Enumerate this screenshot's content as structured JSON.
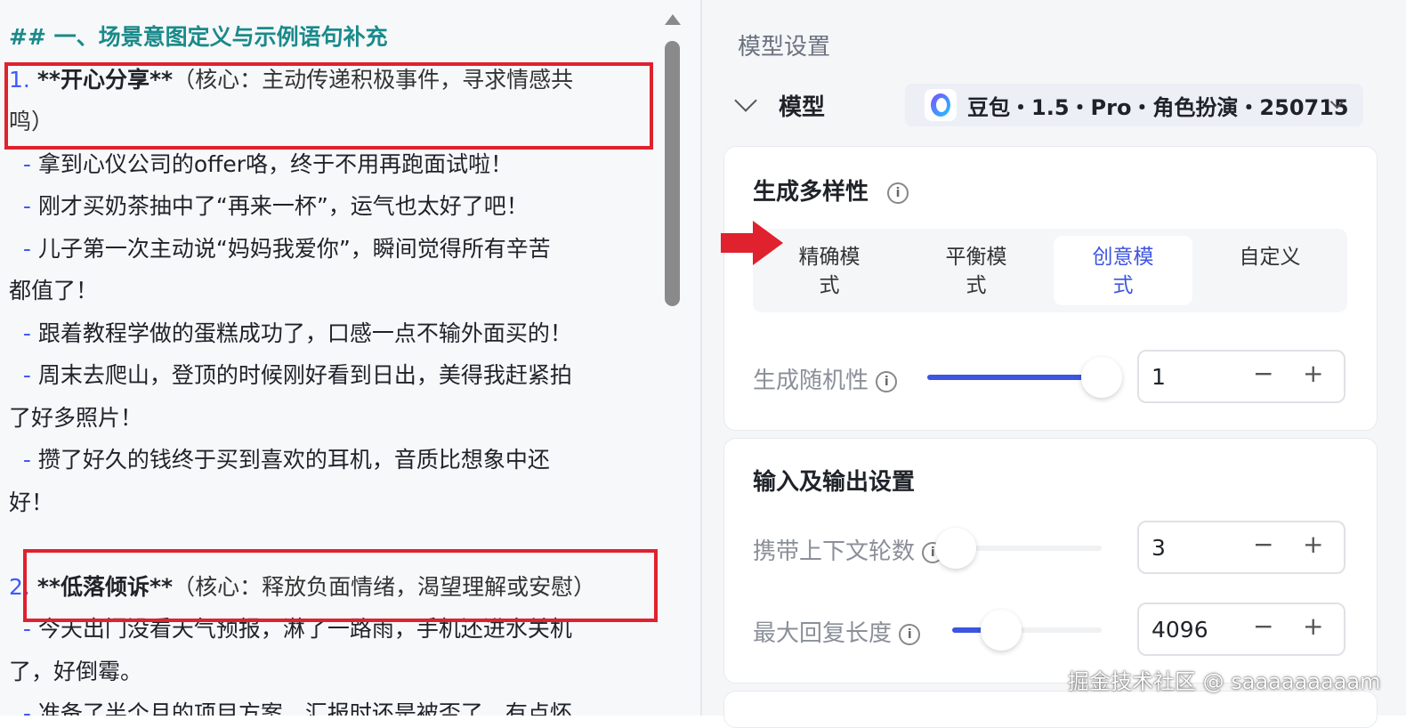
{
  "editor": {
    "heading": "## 一、场景意图定义与示例语句补充",
    "item1": {
      "num": "1.",
      "title": "**开心分享**",
      "desc_a": "（核心：主动传递积极事件，寻求情感共",
      "desc_b": "鸣）"
    },
    "item1_lines": [
      "拿到心仪公司的offer咯，终于不用再跑面试啦！",
      "刚才买奶茶抽中了“再来一杯”，运气也太好了吧！",
      "儿子第一次主动说“妈妈我爱你”，瞬间觉得所有辛苦",
      "都值了！",
      "跟着教程学做的蛋糕成功了，口感一点不输外面买的！",
      "周末去爬山，登顶的时候刚好看到日出，美得我赶紧拍",
      "了好多照片！",
      "攒了好久的钱终于买到喜欢的耳机，音质比想象中还",
      "好！"
    ],
    "dash": "-",
    "item2": {
      "num": "2.",
      "title": "**低落倾诉**",
      "desc": "（核心：释放负面情绪，渴望理解或安慰）"
    },
    "item2_lines": [
      "今天出门没看天气预报，淋了一路雨，手机还进水关机",
      "了，好倒霉。",
      "准备了半个月的项目方案，汇报时还是被否了，有点怀"
    ]
  },
  "settings": {
    "title": "模型设置",
    "model_label": "模型",
    "model_name": "豆包・1.5・Pro・角色扮演・250715",
    "diversity": {
      "title": "生成多样性",
      "modes": [
        "精确模式",
        "平衡模式",
        "创意模式",
        "自定义"
      ],
      "active_index": 2,
      "randomness_label": "生成随机性",
      "randomness_value": "1",
      "randomness_level": 1.0
    },
    "io": {
      "title": "输入及输出设置",
      "context_label": "携带上下文轮数",
      "context_value": "3",
      "context_level": 0.0,
      "maxlen_label": "最大回复长度",
      "maxlen_value": "4096",
      "maxlen_level": 0.33
    },
    "minus": "−",
    "plus": "+",
    "info_glyph": "i"
  },
  "watermark": "掘金技术社区 @ saaaaaaaaam",
  "colors": {
    "accent": "#3d55e0",
    "heading": "#1a8a8a",
    "highlight_box": "#e0212e"
  }
}
